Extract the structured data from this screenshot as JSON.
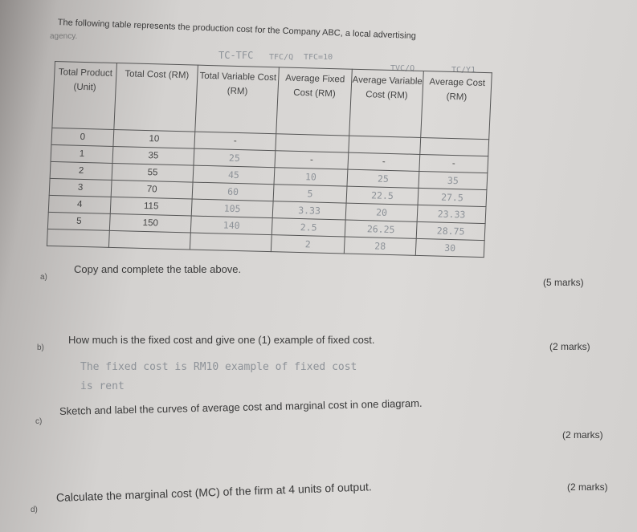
{
  "intro": "The following table represents the production cost for the Company ABC, a local advertising",
  "intro_cont": "agency.",
  "annotations": [
    "TC-TFC",
    "TFC/Q",
    "TFC=10",
    "TVC/Q",
    "TC/Y1"
  ],
  "table": {
    "headers": [
      "Total Product (Unit)",
      "Total Cost (RM)",
      "Total Variable Cost (RM)",
      "Average Fixed Cost (RM)",
      "Average Variable Cost (RM)",
      "Average Cost (RM)"
    ],
    "rows": [
      [
        "0",
        "10",
        "-",
        "",
        "",
        ""
      ],
      [
        "1",
        "35",
        "25",
        "-",
        "-",
        "-"
      ],
      [
        "2",
        "55",
        "45",
        "10",
        "25",
        "35"
      ],
      [
        "3",
        "70",
        "60",
        "5",
        "22.5",
        "27.5"
      ],
      [
        "4",
        "115",
        "105",
        "3.33",
        "20",
        "23.33"
      ],
      [
        "5",
        "150",
        "140",
        "2.5",
        "26.25",
        "28.75"
      ],
      [
        "",
        "",
        "",
        "2",
        "28",
        "30"
      ]
    ]
  },
  "questions": [
    {
      "label": "a)",
      "text": "Copy and complete the table above.",
      "marks": "(5 marks)"
    },
    {
      "label": "b)",
      "text": "How much is the fixed cost and give one (1) example of fixed cost.",
      "marks": "(2 marks)",
      "answer": [
        "The fixed cost is RM10 example of fixed cost",
        "is rent"
      ]
    },
    {
      "label": "c)",
      "text": "Sketch and label the curves of average cost and marginal cost in one diagram.",
      "marks": "(2 marks)"
    },
    {
      "label": "d)",
      "text": "Calculate the marginal cost (MC) of the firm at 4 units of output.",
      "marks": "(2 marks)"
    }
  ]
}
